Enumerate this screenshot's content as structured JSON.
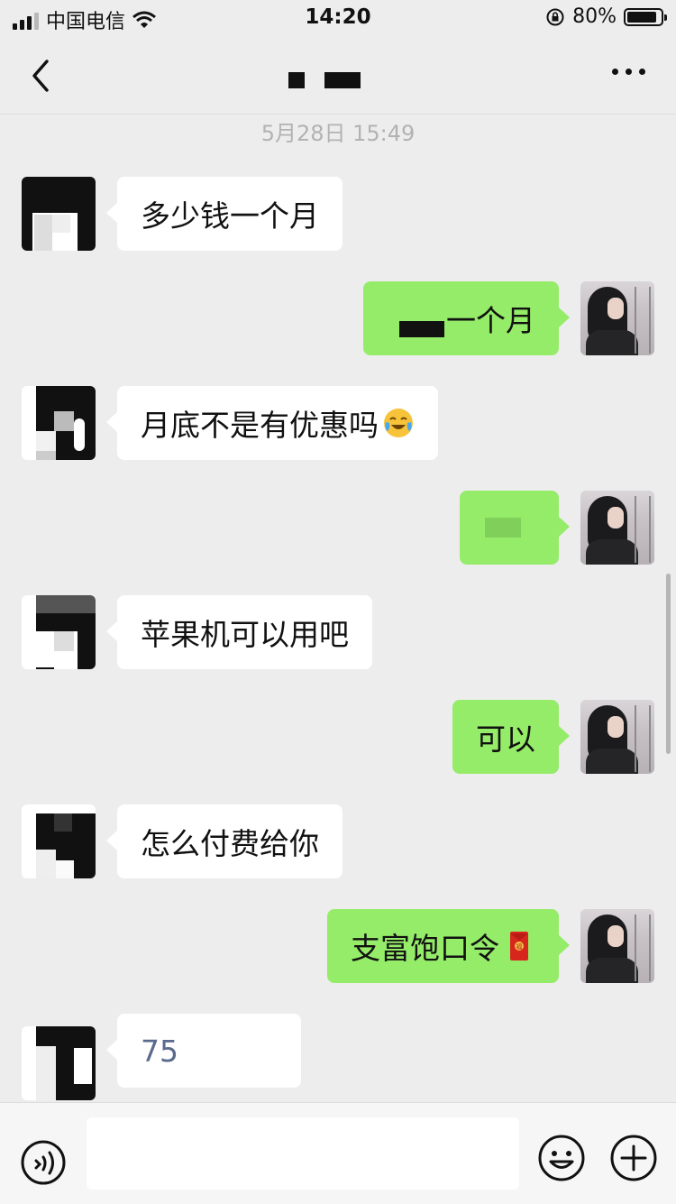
{
  "status_bar": {
    "carrier": "中国电信",
    "time": "14:20",
    "battery": "80%",
    "battery_level": 0.8
  },
  "nav": {
    "back_icon": "chevron-left-icon",
    "more_icon": "more-dots-icon"
  },
  "timestamp": "5月28日 15:49",
  "messages": [
    {
      "side": "left",
      "text": "多少钱一个月"
    },
    {
      "side": "right",
      "text": "一个月"
    },
    {
      "side": "left",
      "text": "月底不是有优惠吗",
      "emoji": "laughing-crying-emoji"
    },
    {
      "side": "right",
      "text": ""
    },
    {
      "side": "left",
      "text": "苹果机可以用吧"
    },
    {
      "side": "right",
      "text": "可以"
    },
    {
      "side": "left",
      "text": "怎么付费给你"
    },
    {
      "side": "right",
      "text": "支富饱口令",
      "emoji": "red-envelope-emoji"
    },
    {
      "side": "left",
      "text": "75"
    }
  ],
  "input_bar": {
    "voice_icon": "voice-icon",
    "emoji_icon": "smile-icon",
    "plus_icon": "plus-icon",
    "placeholder": ""
  },
  "colors": {
    "background": "#ededed",
    "sent_bubble": "#95ec69",
    "received_bubble": "#ffffff"
  }
}
